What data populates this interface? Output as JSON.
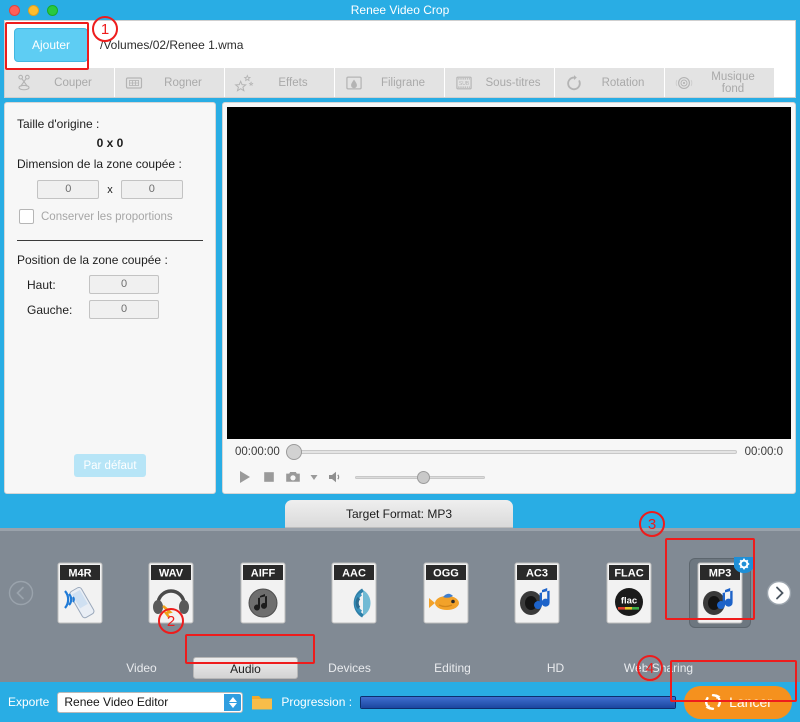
{
  "window": {
    "title": "Renee Video Crop",
    "traffic_lights": [
      "close-button",
      "minimize-button",
      "zoom-button"
    ]
  },
  "header": {
    "add_button": "Ajouter",
    "file_path": "/Volumes/02/Renee 1.wma"
  },
  "toolbar": {
    "items": [
      {
        "label": "Couper",
        "icon": "scissors-icon"
      },
      {
        "label": "Rogner",
        "icon": "crop-grid-icon"
      },
      {
        "label": "Effets",
        "icon": "sparkle-stars-icon"
      },
      {
        "label": "Filigrane",
        "icon": "watermark-droplet-icon"
      },
      {
        "label": "Sous-titres",
        "icon": "subtitle-filmstrip-icon"
      },
      {
        "label": "Rotation",
        "icon": "rotate-icon"
      },
      {
        "label": "Musique fond",
        "icon": "audio-disc-icon"
      }
    ]
  },
  "crop_panel": {
    "original_size_label": "Taille d'origine :",
    "original_size_value": "0 x 0",
    "crop_dimension_label": "Dimension de la zone coupée :",
    "width_value": "0",
    "height_value": "0",
    "x_separator": "x",
    "keep_ratio_label": "Conserver les proportions",
    "keep_ratio_checked": false,
    "position_label": "Position de la zone coupée :",
    "top_label": "Haut:",
    "top_value": "0",
    "left_label": "Gauche:",
    "left_value": "0",
    "default_button": "Par défaut"
  },
  "player": {
    "current_time": "00:00:00",
    "total_time": "00:00:0",
    "seek_position_percent": 0,
    "volume_percent": 48,
    "controls": [
      {
        "name": "play-button",
        "icon": "play-icon"
      },
      {
        "name": "stop-button",
        "icon": "stop-icon"
      },
      {
        "name": "snapshot-button",
        "icon": "camera-icon"
      },
      {
        "name": "snapshot-menu",
        "icon": "chevron-down-icon"
      },
      {
        "name": "volume-button",
        "icon": "speaker-icon"
      }
    ]
  },
  "format_section": {
    "tab_title": "Target Format: MP3",
    "prev_arrow": "chevron-left-icon",
    "next_arrow": "chevron-right-icon",
    "formats": [
      {
        "label": "M4R",
        "icon": "m4r-phone-icon",
        "selected": false
      },
      {
        "label": "WAV",
        "icon": "wav-headphones-icon",
        "selected": false
      },
      {
        "label": "AIFF",
        "icon": "aiff-note-disc-icon",
        "selected": false
      },
      {
        "label": "AAC",
        "icon": "aac-waves-icon",
        "selected": false
      },
      {
        "label": "OGG",
        "icon": "ogg-fish-icon",
        "selected": false
      },
      {
        "label": "AC3",
        "icon": "ac3-speaker-icon",
        "selected": false
      },
      {
        "label": "FLAC",
        "icon": "flac-disc-icon",
        "selected": false
      },
      {
        "label": "MP3",
        "icon": "mp3-speaker-icon",
        "selected": true,
        "badge": "gear-icon"
      }
    ]
  },
  "category_tabs": [
    {
      "label": "Video",
      "active": false
    },
    {
      "label": "Audio",
      "active": true
    },
    {
      "label": "Devices",
      "active": false
    },
    {
      "label": "Editing",
      "active": false
    },
    {
      "label": "HD",
      "active": false
    },
    {
      "label": "Web Sharing",
      "active": false
    }
  ],
  "export_bar": {
    "export_label": "Exporte",
    "export_value": "Renee Video Editor",
    "folder_icon": "folder-icon",
    "progress_label": "Progression :",
    "progress_percent": 100,
    "start_button": "Lancer",
    "start_icon": "refresh-icon"
  },
  "annotations": [
    {
      "number": "1",
      "target": "ajouter-button"
    },
    {
      "number": "2",
      "target": "audio-tab"
    },
    {
      "number": "3",
      "target": "mp3-format"
    },
    {
      "number": "4",
      "target": "lancer-button"
    }
  ],
  "colors": {
    "window_chrome": "#29ade4",
    "accent_blue": "#5ecdf3",
    "format_panel": "#818a94",
    "start_orange": "#f5911e",
    "annotation_red": "#ee1c1c",
    "progress_blue": "#1f4fa8"
  }
}
